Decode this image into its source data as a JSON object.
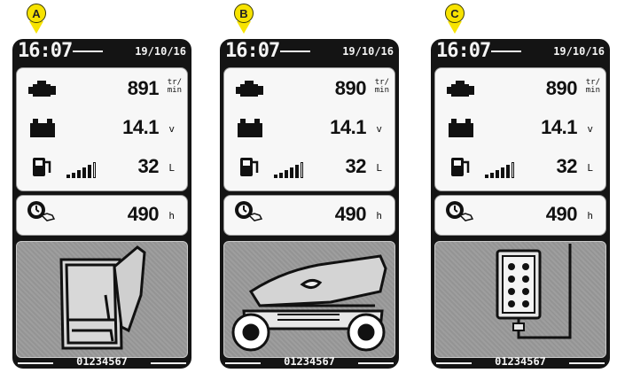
{
  "panels": [
    {
      "callout": "A",
      "clock": "16:07",
      "date": "19/10/16",
      "engine_value": "891",
      "engine_unit_top": "tr/",
      "engine_unit_bottom": "min",
      "battery_value": "14.1",
      "battery_unit": "v",
      "fuel_value": "32",
      "fuel_unit": "L",
      "hours_value": "490",
      "hours_unit": "h",
      "scene": "operator-seat",
      "serial": "01234567"
    },
    {
      "callout": "B",
      "clock": "16:07",
      "date": "19/10/16",
      "engine_value": "890",
      "engine_unit_top": "tr/",
      "engine_unit_bottom": "min",
      "battery_value": "14.1",
      "battery_unit": "v",
      "fuel_value": "32",
      "fuel_unit": "L",
      "hours_value": "490",
      "hours_unit": "h",
      "scene": "mower-tractor",
      "serial": "01234567"
    },
    {
      "callout": "C",
      "clock": "16:07",
      "date": "19/10/16",
      "engine_value": "890",
      "engine_unit_top": "tr/",
      "engine_unit_bottom": "min",
      "battery_value": "14.1",
      "battery_unit": "v",
      "fuel_value": "32",
      "fuel_unit": "L",
      "hours_value": "490",
      "hours_unit": "h",
      "scene": "remote-control-panel",
      "serial": "01234567"
    }
  ],
  "icons": {
    "engine": "engine-icon",
    "battery": "battery-icon",
    "fuel": "fuel-pump-icon",
    "hours": "hour-meter-icon"
  },
  "colors": {
    "callout_fill": "#f7e300",
    "screen_bg": "#141414",
    "box_bg": "#f7f7f7",
    "scene_bg": "#9a9a9a"
  },
  "fuel_level_bars": 5
}
